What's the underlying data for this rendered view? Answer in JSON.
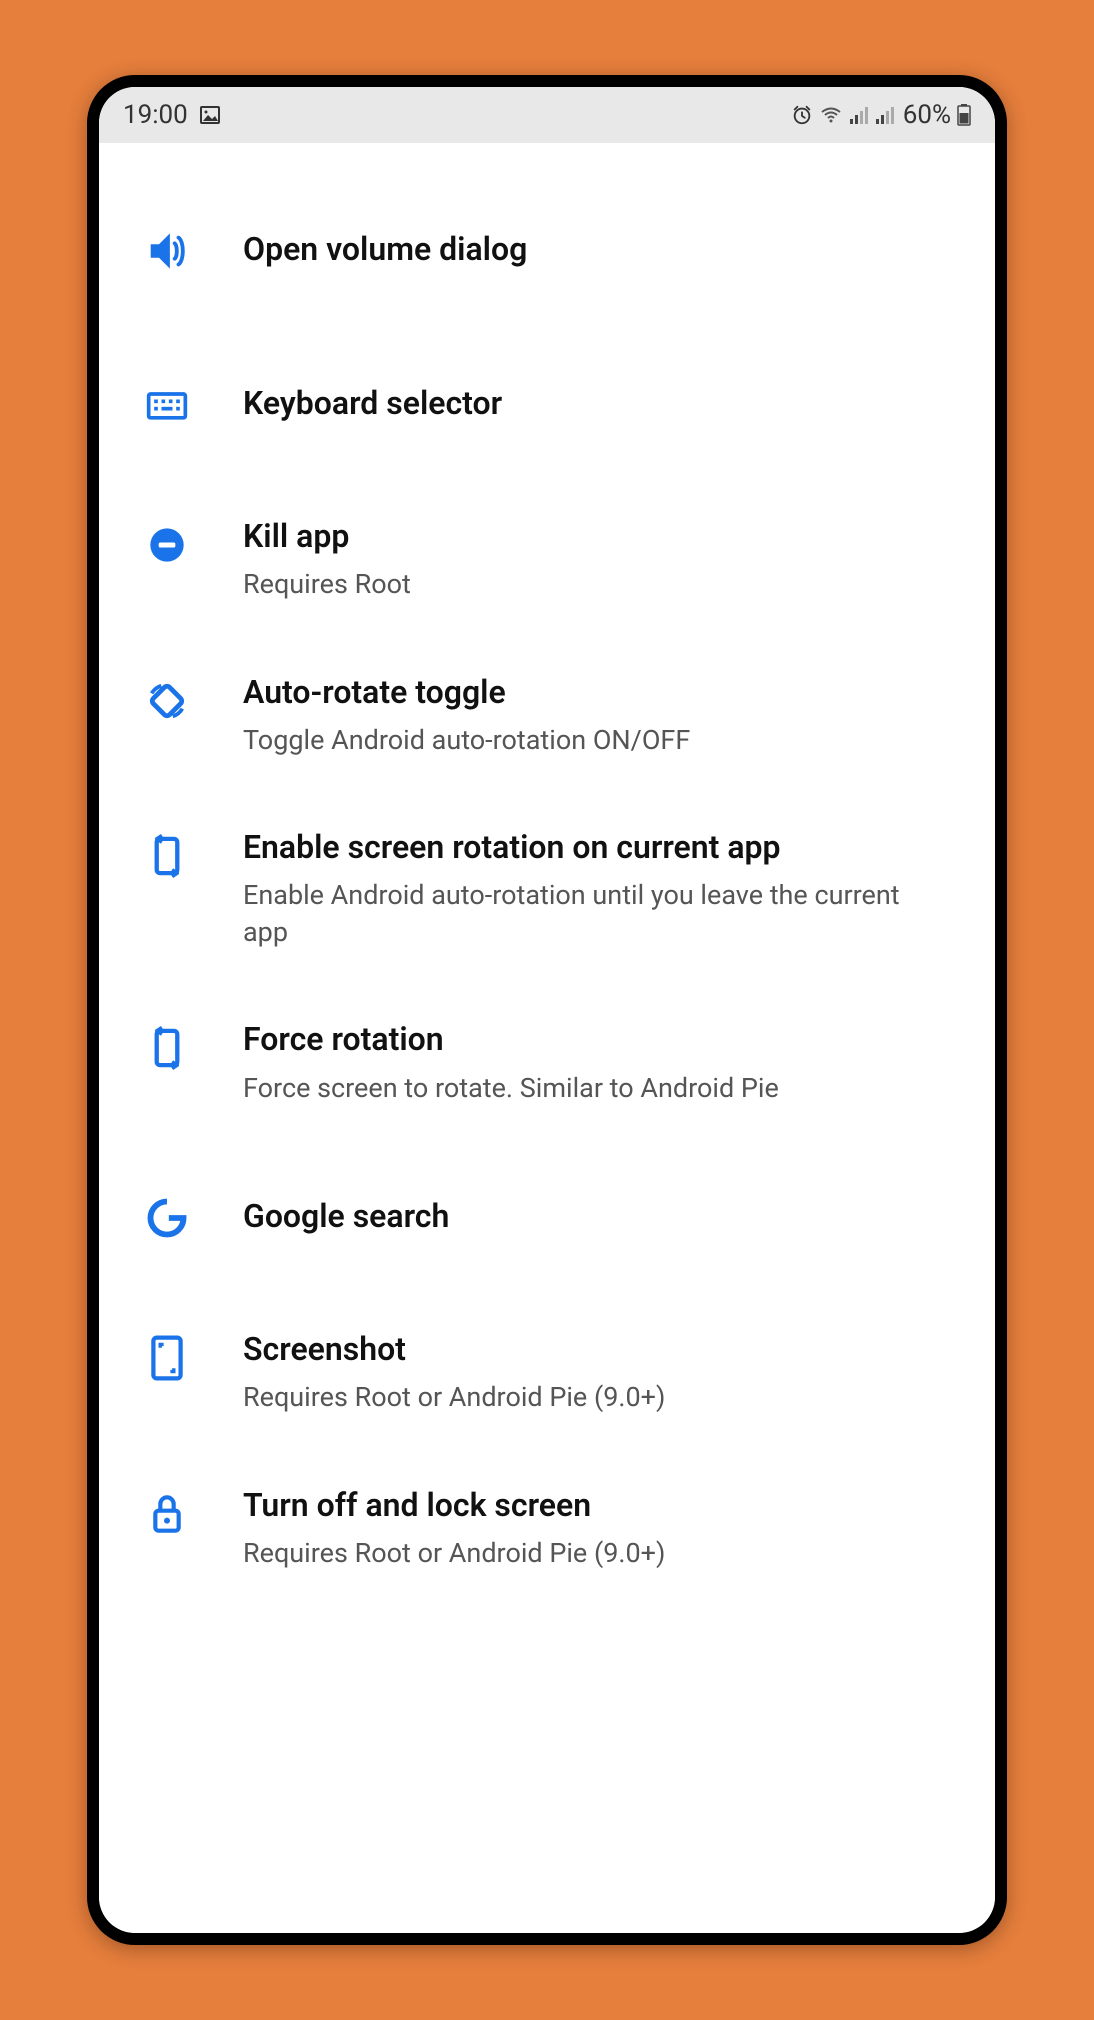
{
  "status_bar": {
    "time": "19:00",
    "battery_text": "60%"
  },
  "items": [
    {
      "icon": "volume-icon",
      "title": "Open volume dialog",
      "subtitle": ""
    },
    {
      "icon": "keyboard-icon",
      "title": "Keyboard selector",
      "subtitle": ""
    },
    {
      "icon": "minus-circle-icon",
      "title": "Kill app",
      "subtitle": "Requires Root"
    },
    {
      "icon": "rotate-icon",
      "title": "Auto-rotate toggle",
      "subtitle": "Toggle Android auto-rotation ON/OFF"
    },
    {
      "icon": "rotate-app-icon",
      "title": "Enable screen rotation on current app",
      "subtitle": "Enable Android auto-rotation until you leave the current app"
    },
    {
      "icon": "rotate-app-icon",
      "title": "Force rotation",
      "subtitle": "Force screen to rotate. Similar to Android Pie"
    },
    {
      "icon": "google-icon",
      "title": "Google search",
      "subtitle": ""
    },
    {
      "icon": "screenshot-icon",
      "title": "Screenshot",
      "subtitle": "Requires Root or Android Pie (9.0+)"
    },
    {
      "icon": "lock-icon",
      "title": "Turn off and lock screen",
      "subtitle": "Requires Root or Android Pie (9.0+)"
    }
  ]
}
